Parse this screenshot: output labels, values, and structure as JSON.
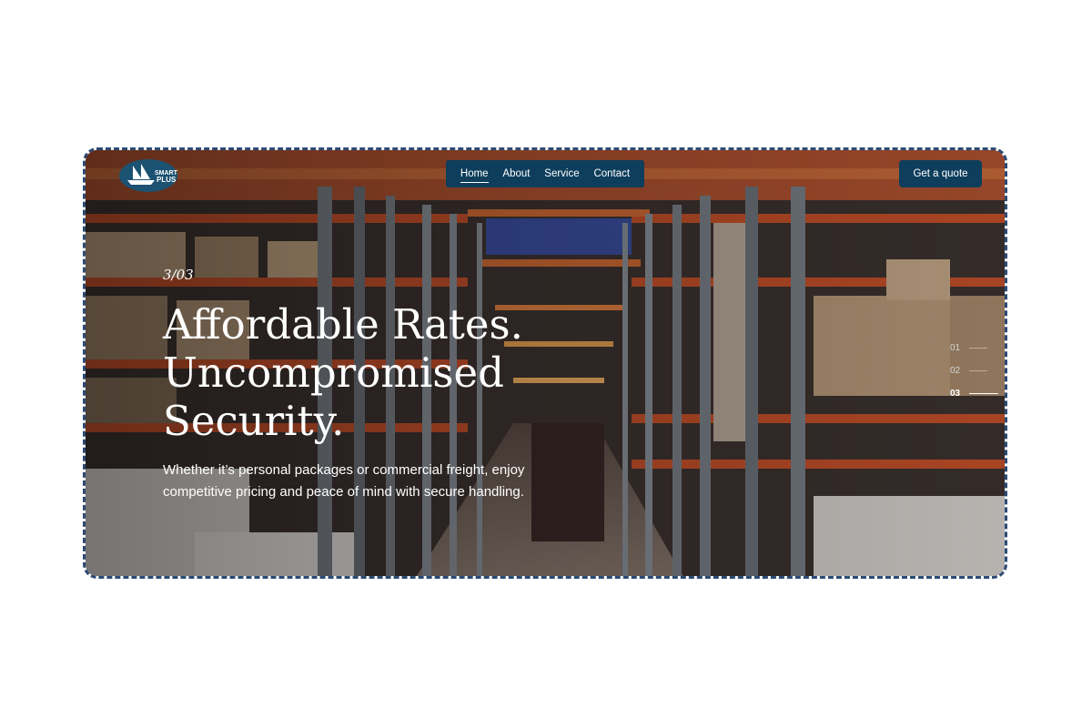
{
  "brand": {
    "logo_text_top": "SMART",
    "logo_text_bottom": "PLUS"
  },
  "nav": {
    "items": [
      {
        "label": "Home",
        "active": true
      },
      {
        "label": "About"
      },
      {
        "label": "Service"
      },
      {
        "label": "Contact"
      }
    ]
  },
  "cta": {
    "label": "Get a quote"
  },
  "hero": {
    "counter": "3/03",
    "headline_lines": [
      "Affordable Rates.",
      "Uncompromised",
      "Security."
    ],
    "description": "Whether it’s personal packages or commercial freight, enjoy competitive pricing and peace of mind with secure handling."
  },
  "slides": {
    "items": [
      "01",
      "02",
      "03"
    ],
    "active_index": 2
  },
  "colors": {
    "nav_bg": "#0e3e5c",
    "frame_border": "#2c4a74",
    "rack_orange": "#c5502a",
    "rack_steel": "#7a8088"
  }
}
